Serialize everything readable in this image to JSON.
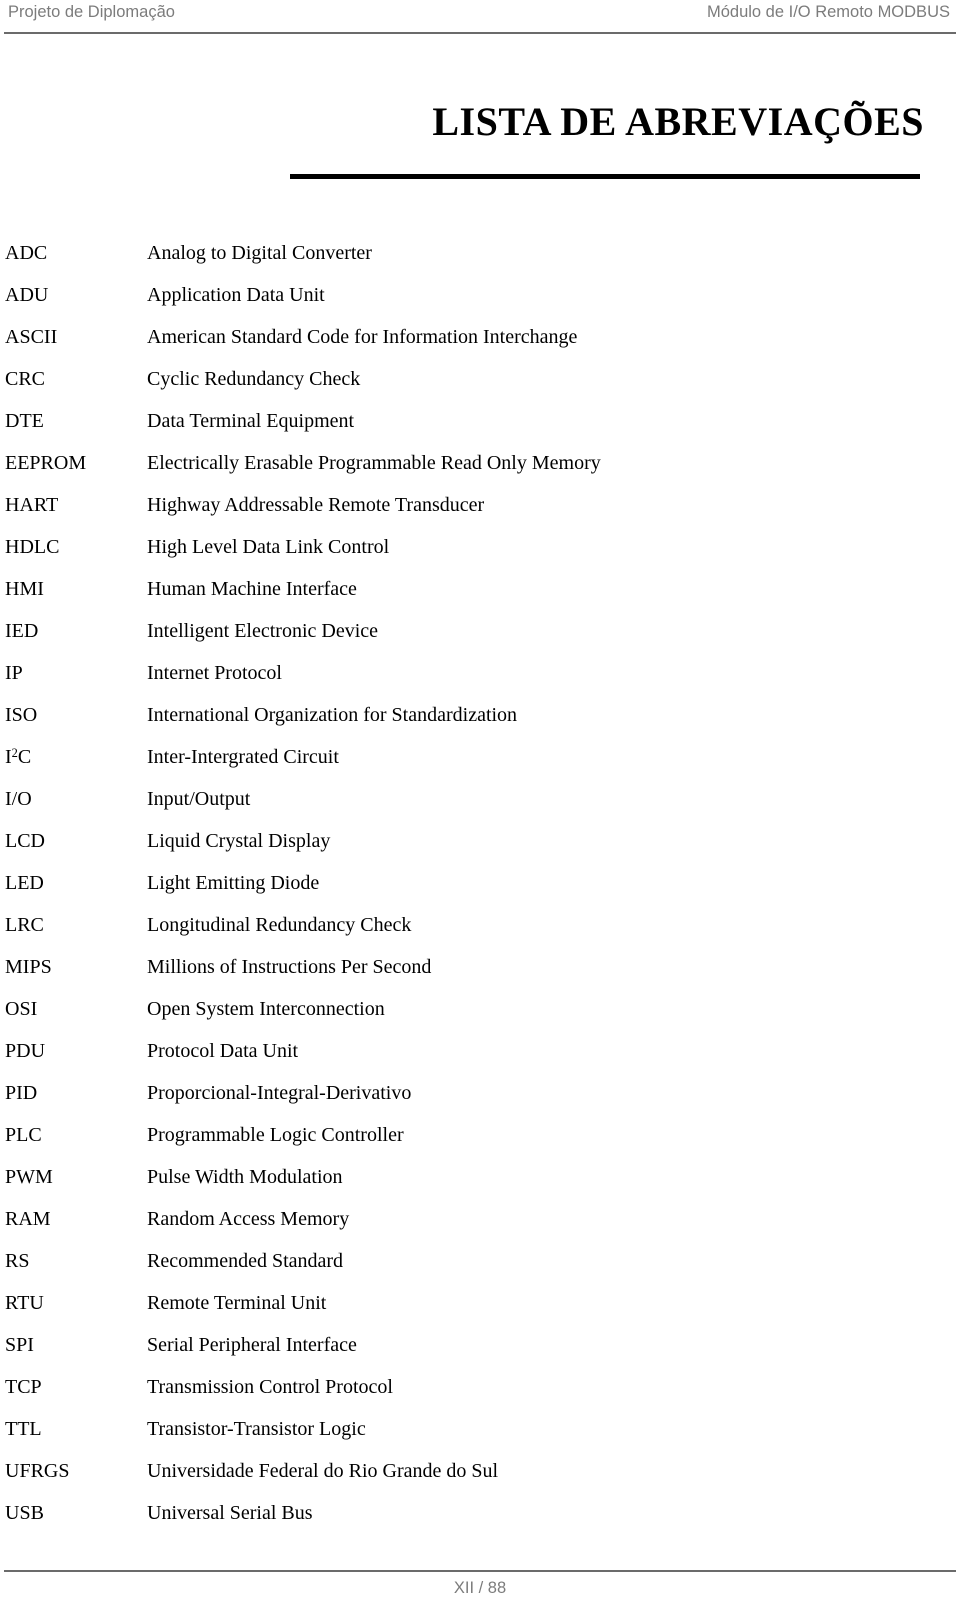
{
  "header": {
    "left": "Projeto de Diplomação",
    "right": "Módulo de I/O Remoto MODBUS"
  },
  "title": "LISTA DE ABREVIAÇÕES",
  "abbreviations": [
    {
      "term": "ADC",
      "term_sup": "",
      "term_tail": "",
      "definition": "Analog to Digital Converter"
    },
    {
      "term": "ADU",
      "term_sup": "",
      "term_tail": "",
      "definition": "Application Data Unit"
    },
    {
      "term": "ASCII",
      "term_sup": "",
      "term_tail": "",
      "definition": "American Standard Code for Information Interchange"
    },
    {
      "term": "CRC",
      "term_sup": "",
      "term_tail": "",
      "definition": "Cyclic Redundancy Check"
    },
    {
      "term": "DTE",
      "term_sup": "",
      "term_tail": "",
      "definition": "Data Terminal Equipment"
    },
    {
      "term": "EEPROM",
      "term_sup": "",
      "term_tail": "",
      "definition": "Electrically Erasable Programmable Read Only Memory"
    },
    {
      "term": "HART",
      "term_sup": "",
      "term_tail": "",
      "definition": "Highway Addressable Remote Transducer"
    },
    {
      "term": "HDLC",
      "term_sup": "",
      "term_tail": "",
      "definition": "High Level Data Link Control"
    },
    {
      "term": "HMI",
      "term_sup": "",
      "term_tail": "",
      "definition": "Human Machine Interface"
    },
    {
      "term": "IED",
      "term_sup": "",
      "term_tail": "",
      "definition": "Intelligent Electronic Device"
    },
    {
      "term": "IP",
      "term_sup": "",
      "term_tail": "",
      "definition": "Internet Protocol"
    },
    {
      "term": "ISO",
      "term_sup": "",
      "term_tail": "",
      "definition": "International Organization for Standardization"
    },
    {
      "term": "I",
      "term_sup": "2",
      "term_tail": "C",
      "definition": "Inter-Intergrated Circuit"
    },
    {
      "term": "I/O",
      "term_sup": "",
      "term_tail": "",
      "definition": "Input/Output"
    },
    {
      "term": "LCD",
      "term_sup": "",
      "term_tail": "",
      "definition": "Liquid Crystal Display"
    },
    {
      "term": "LED",
      "term_sup": "",
      "term_tail": "",
      "definition": "Light Emitting Diode"
    },
    {
      "term": "LRC",
      "term_sup": "",
      "term_tail": "",
      "definition": "Longitudinal Redundancy Check"
    },
    {
      "term": "MIPS",
      "term_sup": "",
      "term_tail": "",
      "definition": "Millions of Instructions Per Second"
    },
    {
      "term": "OSI",
      "term_sup": "",
      "term_tail": "",
      "definition": "Open System Interconnection"
    },
    {
      "term": "PDU",
      "term_sup": "",
      "term_tail": "",
      "definition": "Protocol Data Unit"
    },
    {
      "term": "PID",
      "term_sup": "",
      "term_tail": "",
      "definition": "Proporcional-Integral-Derivativo"
    },
    {
      "term": "PLC",
      "term_sup": "",
      "term_tail": "",
      "definition": "Programmable Logic Controller"
    },
    {
      "term": "PWM",
      "term_sup": "",
      "term_tail": "",
      "definition": "Pulse Width Modulation"
    },
    {
      "term": "RAM",
      "term_sup": "",
      "term_tail": "",
      "definition": "Random Access Memory"
    },
    {
      "term": "RS",
      "term_sup": "",
      "term_tail": "",
      "definition": "Recommended Standard"
    },
    {
      "term": "RTU",
      "term_sup": "",
      "term_tail": "",
      "definition": "Remote Terminal Unit"
    },
    {
      "term": "SPI",
      "term_sup": "",
      "term_tail": "",
      "definition": "Serial Peripheral Interface"
    },
    {
      "term": "TCP",
      "term_sup": "",
      "term_tail": "",
      "definition": "Transmission Control Protocol"
    },
    {
      "term": "TTL",
      "term_sup": "",
      "term_tail": "",
      "definition": "Transistor-Transistor Logic"
    },
    {
      "term": "UFRGS",
      "term_sup": "",
      "term_tail": "",
      "definition": "Universidade Federal do Rio Grande do Sul"
    },
    {
      "term": "USB",
      "term_sup": "",
      "term_tail": "",
      "definition": "Universal Serial Bus"
    }
  ],
  "footer": {
    "page_number": "XII / 88"
  },
  "colors": {
    "header_text": "#7c7c7c",
    "header_rule": "#6b6b6b",
    "title_rule": "#000000",
    "body_text": "#000000",
    "page_background": "#ffffff"
  }
}
